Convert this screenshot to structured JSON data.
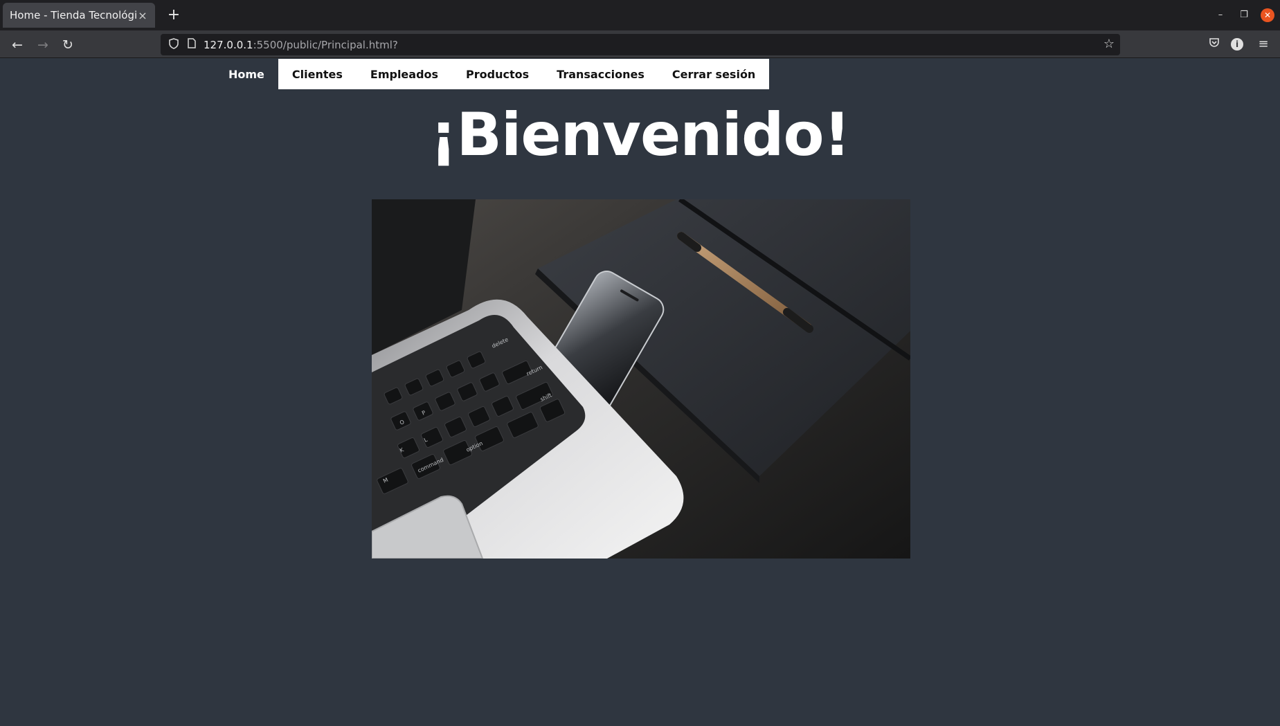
{
  "browser": {
    "tab_title": "Home - Tienda Tecnológica",
    "tab_close": "×",
    "new_tab": "+",
    "url_host": "127.0.0.1",
    "url_path": ":5500/public/Principal.html?"
  },
  "site_nav": {
    "items": [
      {
        "label": "Home",
        "active": true
      },
      {
        "label": "Clientes"
      },
      {
        "label": "Empleados"
      },
      {
        "label": "Productos"
      },
      {
        "label": "Transacciones"
      },
      {
        "label": "Cerrar sesión"
      }
    ]
  },
  "main": {
    "heading": "¡Bienvenido!",
    "hero_keys": [
      "delete",
      "return",
      "shift",
      "option",
      "command",
      "M",
      "K",
      "L",
      "O",
      "P"
    ]
  },
  "colors": {
    "page_bg": "#2f3640",
    "nav_bg": "#ffffff",
    "heading": "#ffffff"
  }
}
